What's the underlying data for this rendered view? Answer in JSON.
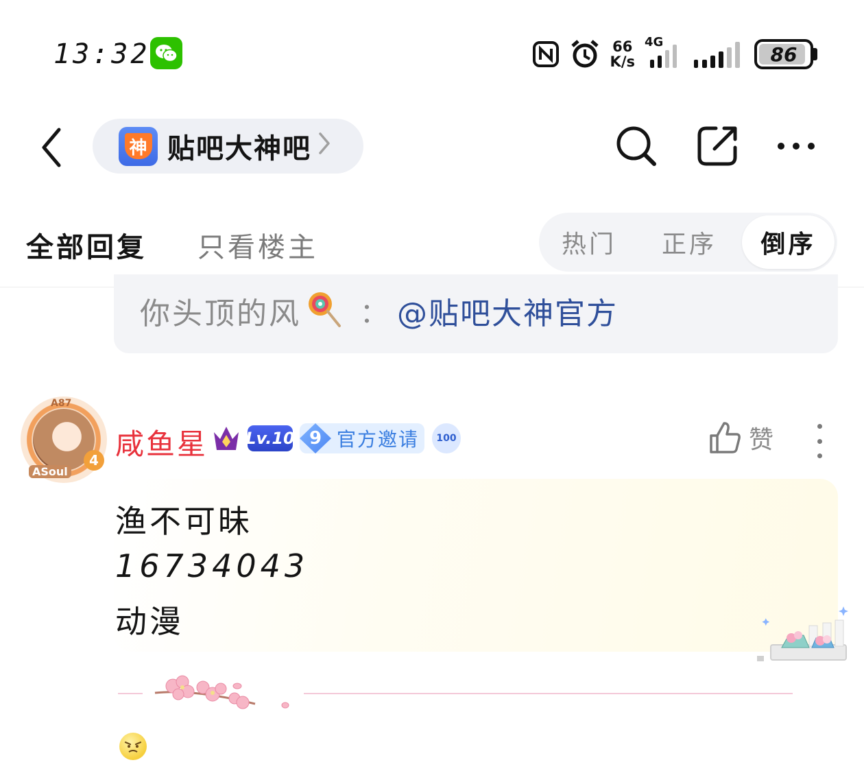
{
  "status_bar": {
    "time": "13:32",
    "net_speed_value": "66",
    "net_speed_unit": "K/s",
    "network_type": "4G",
    "battery_level": "86"
  },
  "nav": {
    "forum_name": "贴吧大神吧",
    "forum_logo_char": "神"
  },
  "tabs": {
    "all_replies": "全部回复",
    "op_only": "只看楼主"
  },
  "sort": {
    "options": [
      "热门",
      "正序",
      "倒序"
    ],
    "selected": "倒序"
  },
  "quote": {
    "user": "你头顶的风",
    "separator": "：",
    "mention": "@贴吧大神官方"
  },
  "post": {
    "username": "咸鱼星",
    "level": "Lv.10",
    "invite_count": "9",
    "invite_label": "官方邀请",
    "calendar_badge": "100",
    "avatar_top_tag": "A87",
    "avatar_bottom_tag": "ASoul",
    "avatar_level": "4",
    "like_label": "赞",
    "lines": [
      "渔不可昧",
      "16734043",
      "动漫"
    ]
  },
  "colors": {
    "username": "#e8323c",
    "mention": "#2f4f9a",
    "level_badge": "#3550e0",
    "wechat": "#2dc100"
  }
}
